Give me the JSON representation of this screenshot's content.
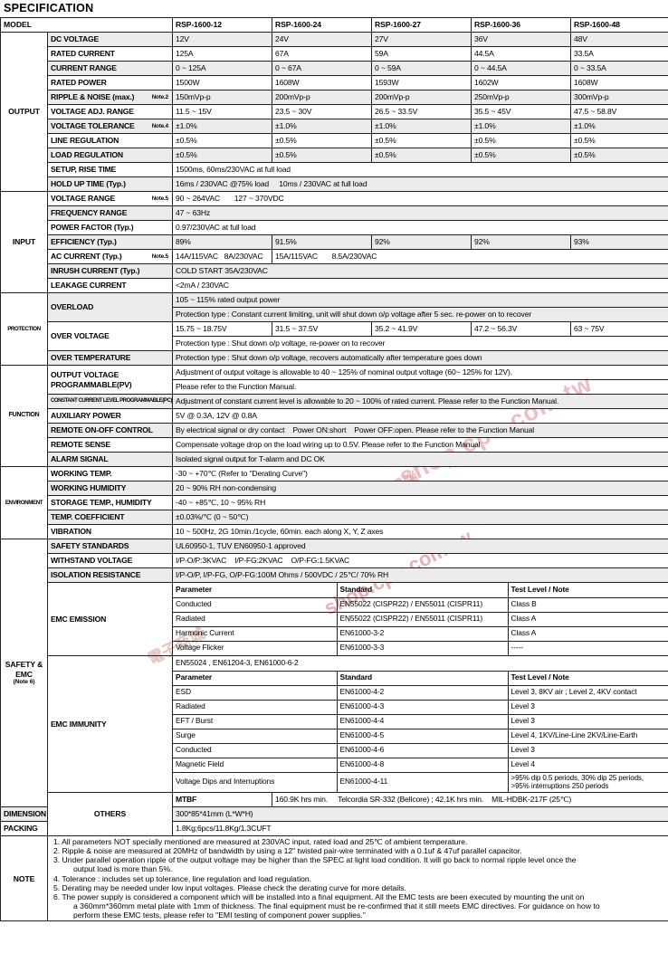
{
  "title": "SPECIFICATION",
  "watermark": {
    "line1": "shop.cpu.com.tw",
    "line2": "電子商城",
    "line3": "電腦",
    "line4": "購物"
  },
  "columns": {
    "model_label": "MODEL",
    "models": [
      "RSP-1600-12",
      "RSP-1600-24",
      "RSP-1600-27",
      "RSP-1600-36",
      "RSP-1600-48"
    ]
  },
  "sections": {
    "output": {
      "label": "OUTPUT",
      "rows": [
        {
          "param": "DC VOLTAGE",
          "note": "",
          "values": [
            "12V",
            "24V",
            "27V",
            "36V",
            "48V"
          ]
        },
        {
          "param": "RATED CURRENT",
          "note": "",
          "values": [
            "125A",
            "67A",
            "59A",
            "44.5A",
            "33.5A"
          ]
        },
        {
          "param": "CURRENT RANGE",
          "note": "",
          "values": [
            "0 ~ 125A",
            "0 ~ 67A",
            "0 ~ 59A",
            "0 ~ 44.5A",
            "0 ~ 33.5A"
          ]
        },
        {
          "param": "RATED POWER",
          "note": "",
          "values": [
            "1500W",
            "1608W",
            "1593W",
            "1602W",
            "1608W"
          ]
        },
        {
          "param": "RIPPLE & NOISE (max.)",
          "note": "Note.2",
          "values": [
            "150mVp-p",
            "200mVp-p",
            "200mVp-p",
            "250mVp-p",
            "300mVp-p"
          ]
        },
        {
          "param": "VOLTAGE ADJ. RANGE",
          "note": "",
          "values": [
            "11.5 ~ 15V",
            "23.5 ~ 30V",
            "26.5 ~ 33.5V",
            "35.5 ~ 45V",
            "47.5 ~ 58.8V"
          ]
        },
        {
          "param": "VOLTAGE TOLERANCE",
          "note": "Note.4",
          "values": [
            "±1.0%",
            "±1.0%",
            "±1.0%",
            "±1.0%",
            "±1.0%"
          ]
        },
        {
          "param": "LINE REGULATION",
          "note": "",
          "values": [
            "±0.5%",
            "±0.5%",
            "±0.5%",
            "±0.5%",
            "±0.5%"
          ]
        },
        {
          "param": "LOAD REGULATION",
          "note": "",
          "values": [
            "±0.5%",
            "±0.5%",
            "±0.5%",
            "±0.5%",
            "±0.5%"
          ]
        }
      ],
      "setup_rise_time": {
        "param": "SETUP, RISE TIME",
        "value": "1500ms, 60ms/230VAC at full load"
      },
      "hold_up_time": {
        "param": "HOLD UP TIME (Typ.)",
        "value": "16ms / 230VAC @75% load     10ms / 230VAC at full load"
      }
    },
    "input": {
      "label": "INPUT",
      "voltage_range": {
        "param": "VOLTAGE RANGE",
        "note": "Note.5",
        "value": "90 ~ 264VAC       127 ~ 370VDC"
      },
      "frequency_range": {
        "param": "FREQUENCY RANGE",
        "value": "47 ~ 63Hz"
      },
      "power_factor": {
        "param": "POWER FACTOR (Typ.)",
        "value": "0.97/230VAC at full load"
      },
      "efficiency": {
        "param": "EFFICIENCY (Typ.)",
        "values": [
          "89%",
          "91.5%",
          "92%",
          "92%",
          "93%"
        ]
      },
      "ac_current": {
        "param": "AC CURRENT (Typ.)",
        "note": "Note.5",
        "value_a": "14A/115VAC   8A/230VAC",
        "value_b": "15A/115VAC       8.5A/230VAC"
      },
      "inrush_current": {
        "param": "INRUSH CURRENT (Typ.)",
        "value": "COLD START 35A/230VAC"
      },
      "leakage_current": {
        "param": "LEAKAGE CURRENT",
        "value": "<2mA / 230VAC"
      }
    },
    "protection": {
      "label": "PROTECTION",
      "overload": {
        "param": "OVERLOAD",
        "value1": "105 ~ 115% rated output power",
        "value2": "Protection type : Constant current limiting, unit will shut down o/p voltage after 5 sec. re-power on to recover"
      },
      "over_voltage": {
        "param": "OVER VOLTAGE",
        "values": [
          "15.75 ~ 18.75V",
          "31.5 ~ 37.5V",
          "35.2 ~ 41.9V",
          "47.2 ~ 56.3V",
          "63 ~ 75V"
        ],
        "value2": "Protection type : Shut down o/p voltage, re-power on to recover"
      },
      "over_temperature": {
        "param": "OVER TEMPERATURE",
        "value": "Protection type :  Shut down o/p voltage, recovers automatically after temperature goes down"
      }
    },
    "function": {
      "label": "FUNCTION",
      "rows": [
        {
          "param": "OUTPUT VOLTAGE\nPROGRAMMABLE(PV)",
          "param_l1": "OUTPUT VOLTAGE",
          "param_l2": "PROGRAMMABLE(PV)",
          "value_l1": "Adjustment of output voltage is allowable to 40 ~ 125% of nominal output voltage (60~ 125% for 12V).",
          "value_l2": "Please refer to the Function Manual."
        },
        {
          "param": "CONSTANT CURRENT LEVEL PROGRAMMABLE(PC)",
          "value": "Adjustment of constant current level is allowable to 20 ~ 100% of rated current. Please refer to the Function Manual."
        },
        {
          "param": "AUXILIARY POWER",
          "value": "5V @ 0.3A, 12V @ 0.8A"
        },
        {
          "param": "REMOTE ON-OFF CONTROL",
          "value": "By electrical signal or dry contact    Power ON:short    Power OFF:open. Please refer to the Function Manual"
        },
        {
          "param": "REMOTE SENSE",
          "value": "Compensate voltage drop on the load wiring up to 0.5V. Please refer to the Function Manual"
        },
        {
          "param": "ALARM SIGNAL",
          "value": "Isolated signal output for T-alarm and DC OK"
        }
      ]
    },
    "environment": {
      "label": "ENVIRONMENT",
      "rows": [
        {
          "param": "WORKING TEMP.",
          "value": "-30 ~ +70℃ (Refer to \"Derating Curve\")"
        },
        {
          "param": "WORKING HUMIDITY",
          "value": "20 ~ 90% RH non-condensing"
        },
        {
          "param": "STORAGE TEMP., HUMIDITY",
          "value": "-40 ~ +85℃, 10 ~ 95% RH"
        },
        {
          "param": "TEMP. COEFFICIENT",
          "value": "±0.03%/℃ (0 ~ 50℃)"
        },
        {
          "param": "VIBRATION",
          "value": "10 ~ 500Hz, 2G 10min./1cycle, 60min. each along X, Y, Z axes"
        }
      ]
    },
    "safety": {
      "label_l1": "SAFETY &",
      "label_l2": "EMC",
      "label_note": "(Note 6)",
      "rows": [
        {
          "param": "SAFETY STANDARDS",
          "value": "UL60950-1, TUV EN60950-1 approved"
        },
        {
          "param": "WITHSTAND VOLTAGE",
          "value": "I/P-O/P:3KVAC    I/P-FG:2KVAC    O/P-FG:1.5KVAC"
        },
        {
          "param": "ISOLATION RESISTANCE",
          "value": "I/P-O/P, I/P-FG, O/P-FG:100M Ohms / 500VDC / 25℃/ 70% RH"
        }
      ],
      "emc_emission": {
        "param": "EMC EMISSION",
        "headers": [
          "Parameter",
          "Standard",
          "Test Level / Note"
        ],
        "rows": [
          [
            "Conducted",
            "EN55022 (CISPR22) / EN55011 (CISPR11)",
            "Class B"
          ],
          [
            "Radiated",
            "EN55022 (CISPR22) / EN55011 (CISPR11)",
            "Class A"
          ],
          [
            "Harmonic Current",
            "EN61000-3-2",
            "Class A"
          ],
          [
            "Voltage Flicker",
            "EN61000-3-3",
            "-----"
          ]
        ]
      },
      "emc_immunity": {
        "param": "EMC IMMUNITY",
        "standards_line": "EN55024 , EN61204-3, EN61000-6-2",
        "headers": [
          "Parameter",
          "Standard",
          "Test Level / Note"
        ],
        "rows": [
          [
            "ESD",
            "EN61000-4-2",
            "Level 3, 8KV air ; Level 2, 4KV contact"
          ],
          [
            "Radiated",
            "EN61000-4-3",
            "Level 3"
          ],
          [
            "EFT / Burst",
            "EN61000-4-4",
            "Level 3"
          ],
          [
            "Surge",
            "EN61000-4-5",
            "Level 4, 1KV/Line-Line 2KV/Line-Earth"
          ],
          [
            "Conducted",
            "EN61000-4-6",
            "Level 3"
          ],
          [
            "Magnetic Field",
            "EN61000-4-8",
            "Level 4"
          ],
          [
            "Voltage Dips and Interruptions",
            "EN61000-4-11",
            ">95% dip 0.5 periods, 30% dip 25 periods,\n>95% interruptions 250 periods"
          ]
        ],
        "dips_line1": ">95% dip 0.5 periods, 30% dip 25 periods,",
        "dips_line2": ">95% interruptions 250 periods"
      }
    },
    "others": {
      "label": "OTHERS",
      "rows": [
        {
          "param": "MTBF",
          "value": "160.9K hrs min.     Telcordia SR-332 (Bellcore) ; 42.1K hrs min.    MIL-HDBK-217F (25℃)"
        },
        {
          "param": "DIMENSION",
          "value": "300*85*41mm (L*W*H)"
        },
        {
          "param": "PACKING",
          "value": "1.8Kg;6pcs/11.8Kg/1.3CUFT"
        }
      ]
    },
    "note": {
      "label": "NOTE",
      "lines": [
        "1. All parameters NOT specially mentioned are measured at 230VAC input, rated load and 25℃ of ambient temperature.",
        "2. Ripple & noise are measured at 20MHz of bandwidth by using a 12\" twisted pair-wire terminated with a 0.1uf & 47uf parallel capacitor.",
        "3. Under parallel operation ripple of the output voltage may be higher than the SPEC at light load condition. It will go back to normal ripple level once the",
        "output load is more than 5%.",
        "4. Tolerance : includes set up tolerance, line regulation and load regulation.",
        "5. Derating may be needed under low input voltages. Please check the derating curve for more details.",
        "6. The power supply is considered a component which will be installed into a final equipment. All the EMC tests are been executed by mounting the unit on",
        "a 360mm*360mm metal plate with 1mm of thickness. The final equipment must be re-confirmed that it still meets EMC directives. For guidance on how to",
        "perform these EMC tests, please refer to \"EMI testing of component power supplies.\""
      ]
    }
  }
}
